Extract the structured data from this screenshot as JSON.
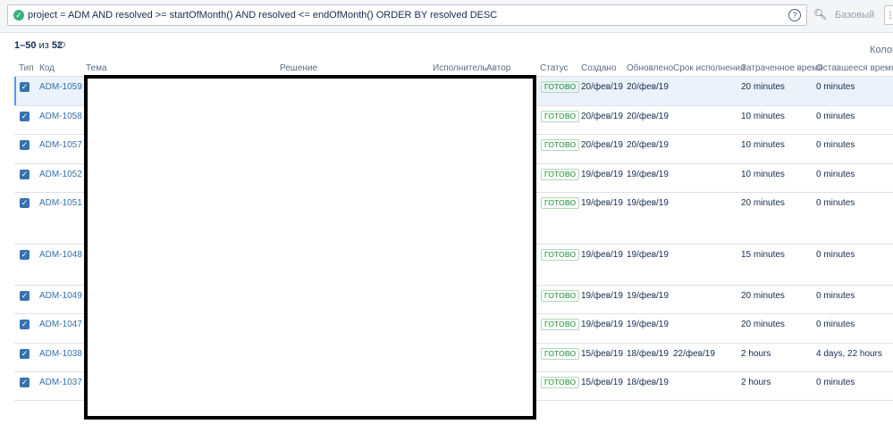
{
  "search": {
    "query": "project = ADM AND resolved >= startOfMonth() AND resolved <= endOfMonth() ORDER BY resolved DESC",
    "valid_icon": "check-circle-icon",
    "help_icon": "question-circle-icon",
    "search_icon": "magnifier-icon",
    "mode_label": "Базовый"
  },
  "results": {
    "range": "1–50",
    "of_label": "из",
    "total": "52",
    "refresh_icon": "refresh-icon"
  },
  "columns_button": "Колон",
  "headers": {
    "type": "Тип",
    "key": "Код",
    "summary": "Тема",
    "resolution": "Решение",
    "assignee": "Исполнитель",
    "reporter": "Автор",
    "status": "Статус",
    "created": "Создано",
    "updated": "Обновлено",
    "due": "Срок исполнения",
    "time_spent": "Затраченное время",
    "remaining": "Оставшееся время"
  },
  "rows": [
    {
      "key": "ADM-1059",
      "status": "ГОТОВО",
      "created": "20/фев/19",
      "updated": "20/фев/19",
      "due": "",
      "spent": "20 minutes",
      "remaining": "0 minutes"
    },
    {
      "key": "ADM-1058",
      "status": "ГОТОВО",
      "created": "20/фев/19",
      "updated": "20/фев/19",
      "due": "",
      "spent": "10 minutes",
      "remaining": "0 minutes"
    },
    {
      "key": "ADM-1057",
      "status": "ГОТОВО",
      "created": "20/фев/19",
      "updated": "20/фев/19",
      "due": "",
      "spent": "10 minutes",
      "remaining": "0 minutes"
    },
    {
      "key": "ADM-1052",
      "status": "ГОТОВО",
      "created": "19/фев/19",
      "updated": "19/фев/19",
      "due": "",
      "spent": "10 minutes",
      "remaining": "0 minutes"
    },
    {
      "key": "ADM-1051",
      "status": "ГОТОВО",
      "created": "19/фев/19",
      "updated": "19/фев/19",
      "due": "",
      "spent": "20 minutes",
      "remaining": "0 minutes"
    },
    {
      "key": "ADM-1048",
      "status": "ГОТОВО",
      "created": "19/фев/19",
      "updated": "19/фев/19",
      "due": "",
      "spent": "15 minutes",
      "remaining": "0 minutes"
    },
    {
      "key": "ADM-1049",
      "status": "ГОТОВО",
      "created": "19/фев/19",
      "updated": "19/фев/19",
      "due": "",
      "spent": "20 minutes",
      "remaining": "0 minutes"
    },
    {
      "key": "ADM-1047",
      "status": "ГОТОВО",
      "created": "19/фев/19",
      "updated": "19/фев/19",
      "due": "",
      "spent": "20 minutes",
      "remaining": "0 minutes"
    },
    {
      "key": "ADM-1038",
      "status": "ГОТОВО",
      "created": "15/фев/19",
      "updated": "18/фев/19",
      "due": "22/фев/19",
      "spent": "2 hours",
      "remaining": "4 days, 22 hours"
    },
    {
      "key": "ADM-1037",
      "status": "ГОТОВО",
      "created": "15/фев/19",
      "updated": "18/фев/19",
      "due": "",
      "spent": "2 hours",
      "remaining": "0 minutes"
    }
  ]
}
